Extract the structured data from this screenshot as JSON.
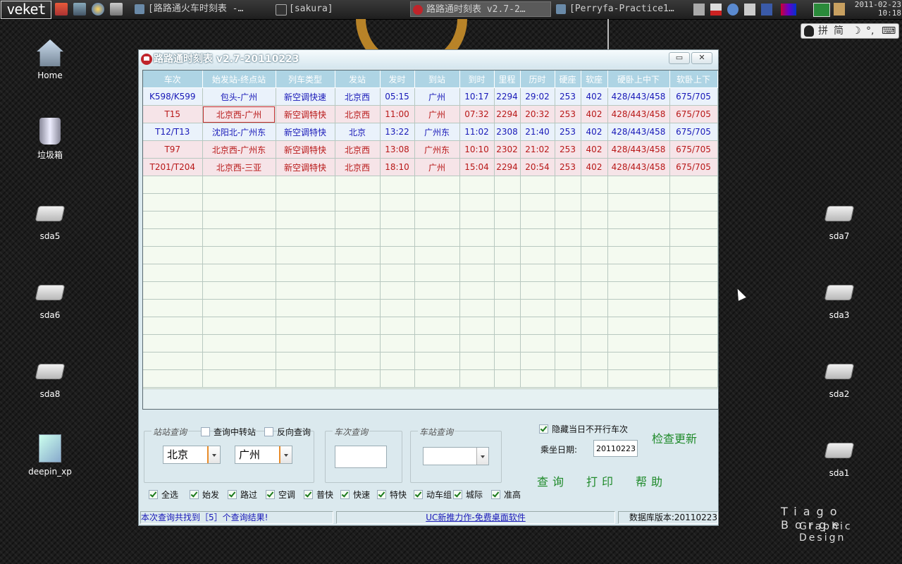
{
  "taskbar": {
    "logo": "veket",
    "tasks": [
      {
        "label": "[路路通火车时刻表 -…",
        "active": false
      },
      {
        "label": "[sakura]",
        "active": false
      },
      {
        "label": "路路通时刻表 v2.7-2…",
        "active": true
      },
      {
        "label": "[Perryfa-Practice1…",
        "active": false
      }
    ],
    "clock_date": "2011-02-23",
    "clock_time": "10:18"
  },
  "ime": {
    "mode": "拼",
    "charset": "简"
  },
  "desktop_icons": [
    {
      "label": "Home",
      "icon": "home-icon"
    },
    {
      "label": "垃圾箱",
      "icon": "trash-icon"
    },
    {
      "label": "sda5",
      "icon": "drive-icon"
    },
    {
      "label": "sda6",
      "icon": "drive-icon"
    },
    {
      "label": "sda8",
      "icon": "drive-icon"
    },
    {
      "label": "deepin_xp",
      "icon": "disk-image-icon"
    },
    {
      "label": "sda7",
      "icon": "drive-icon"
    },
    {
      "label": "sda3",
      "icon": "drive-icon"
    },
    {
      "label": "sda2",
      "icon": "drive-icon"
    },
    {
      "label": "sda1",
      "icon": "drive-icon"
    }
  ],
  "wallpaper": {
    "line1": "Tiago Borge",
    "line2": "Graphic Design"
  },
  "window": {
    "title": "路路通时刻表 v2.7-20110223",
    "minimize": "▭",
    "close": "✕"
  },
  "grid": {
    "columns": [
      "车次",
      "始发站-终点站",
      "列车类型",
      "发站",
      "发时",
      "到站",
      "到时",
      "里程",
      "历时",
      "硬座",
      "软座",
      "硬卧上中下",
      "软卧上下"
    ],
    "rows": [
      {
        "color": "blue",
        "cells": [
          "K598/K599",
          "包头-广州",
          "新空调快速",
          "北京西",
          "05:15",
          "广州",
          "10:17",
          "2294",
          "29:02",
          "253",
          "402",
          "428/443/458",
          "675/705"
        ]
      },
      {
        "color": "red",
        "selected": 1,
        "cells": [
          "T15",
          "北京西-广州",
          "新空调特快",
          "北京西",
          "11:00",
          "广州",
          "07:32",
          "2294",
          "20:32",
          "253",
          "402",
          "428/443/458",
          "675/705"
        ]
      },
      {
        "color": "blue",
        "cells": [
          "T12/T13",
          "沈阳北-广州东",
          "新空调特快",
          "北京",
          "13:22",
          "广州东",
          "11:02",
          "2308",
          "21:40",
          "253",
          "402",
          "428/443/458",
          "675/705"
        ]
      },
      {
        "color": "red",
        "cells": [
          "T97",
          "北京西-广州东",
          "新空调特快",
          "北京西",
          "13:08",
          "广州东",
          "10:10",
          "2302",
          "21:02",
          "253",
          "402",
          "428/443/458",
          "675/705"
        ]
      },
      {
        "color": "red",
        "cells": [
          "T201/T204",
          "北京西-三亚",
          "新空调特快",
          "北京西",
          "18:10",
          "广州",
          "15:04",
          "2294",
          "20:54",
          "253",
          "402",
          "428/443/458",
          "675/705"
        ]
      }
    ],
    "empty_rows": 12
  },
  "station_query": {
    "legend": "站站查询",
    "transfer_label": "查询中转站",
    "transfer_checked": false,
    "reverse_label": "反向查询",
    "reverse_checked": false,
    "from": "北京",
    "to": "广州"
  },
  "train_query": {
    "legend": "车次查询",
    "value": ""
  },
  "stop_query": {
    "legend": "车站查询",
    "value": ""
  },
  "options": {
    "hide_label": "隐藏当日不开行车次",
    "hide_checked": true,
    "date_label": "乘坐日期:",
    "date_value": "20110223",
    "check_update": "检查更新"
  },
  "actions": {
    "query": "查询",
    "print": "打印",
    "help": "帮助"
  },
  "filters": [
    {
      "label": "全选",
      "checked": true
    },
    {
      "label": "始发",
      "checked": true
    },
    {
      "label": "路过",
      "checked": true
    },
    {
      "label": "空调",
      "checked": true
    },
    {
      "label": "普快",
      "checked": true
    },
    {
      "label": "快速",
      "checked": true
    },
    {
      "label": "特快",
      "checked": true
    },
    {
      "label": "动车组",
      "checked": true
    },
    {
      "label": "城际",
      "checked": true
    },
    {
      "label": "准高",
      "checked": true
    }
  ],
  "status": {
    "result": "本次查询共找到［5］个查询结果!",
    "ad": "UC新推力作-免费桌面软件",
    "db_version": "数据库版本:20110223"
  }
}
